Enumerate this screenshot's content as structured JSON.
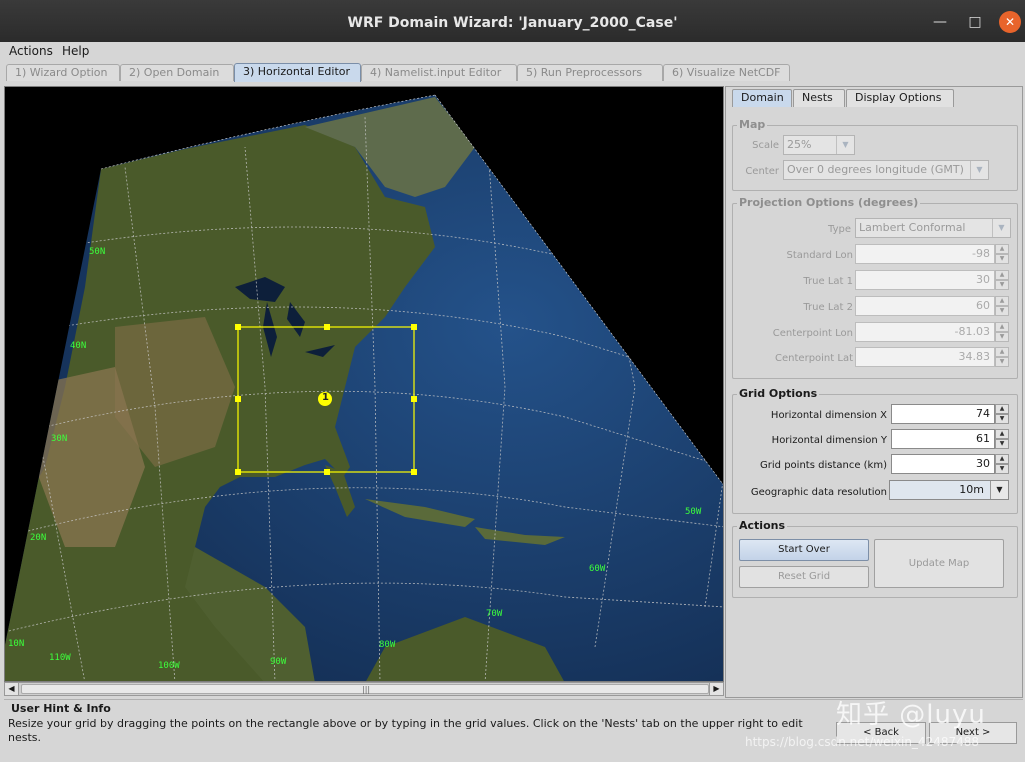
{
  "window": {
    "title": "WRF Domain Wizard: 'January_2000_Case'",
    "min_glyph": "—",
    "max_glyph": "□",
    "close_glyph": "✕"
  },
  "menu": [
    "Actions",
    "Help"
  ],
  "wizard_tabs": [
    {
      "label": "1) Wizard Option",
      "active": false
    },
    {
      "label": "2) Open Domain",
      "active": false
    },
    {
      "label": "3) Horizontal Editor",
      "active": true
    },
    {
      "label": "4) Namelist.input Editor",
      "active": false
    },
    {
      "label": "5) Run Preprocessors",
      "active": false
    },
    {
      "label": "6) Visualize NetCDF",
      "active": false
    }
  ],
  "map": {
    "lat_labels": [
      "50N",
      "40N",
      "30N",
      "20N",
      "10N"
    ],
    "lon_labels": [
      "110W",
      "100W",
      "90W",
      "80W",
      "70W",
      "60W",
      "50W"
    ],
    "domain_marker": "1",
    "colors": {
      "ocean": "#1c3f6e",
      "land": "#4d5a2e",
      "grid": "#c8c8c8",
      "domain_box": "#ffff00",
      "label": "#3cff3c"
    }
  },
  "right_tabs": [
    {
      "label": "Domain",
      "active": true
    },
    {
      "label": "Nests",
      "active": false
    },
    {
      "label": "Display Options",
      "active": false
    }
  ],
  "map_group": {
    "title": "Map",
    "scale_label": "Scale",
    "scale_value": "25%",
    "center_label": "Center",
    "center_value": "Over 0 degrees longitude (GMT)"
  },
  "projection_group": {
    "title": "Projection Options (degrees)",
    "type_label": "Type",
    "type_value": "Lambert Conformal",
    "fields": [
      {
        "label": "Standard Lon",
        "value": "-98"
      },
      {
        "label": "True Lat 1",
        "value": "30"
      },
      {
        "label": "True Lat 2",
        "value": "60"
      },
      {
        "label": "Centerpoint Lon",
        "value": "-81.03"
      },
      {
        "label": "Centerpoint Lat",
        "value": "34.83"
      }
    ]
  },
  "grid_group": {
    "title": "Grid Options",
    "fields": [
      {
        "label": "Horizontal dimension X",
        "value": "74"
      },
      {
        "label": "Horizontal dimension Y",
        "value": "61"
      },
      {
        "label": "Grid points distance (km)",
        "value": "30"
      }
    ],
    "resolution_label": "Geographic data resolution",
    "resolution_value": "10m"
  },
  "actions_group": {
    "title": "Actions",
    "start_over": "Start Over",
    "reset_grid": "Reset Grid",
    "update_map": "Update Map"
  },
  "hint": {
    "title": "User Hint & Info",
    "text": "Resize your grid by dragging the points on the rectangle above or by typing in the grid values. Click on the 'Nests' tab on the upper right to edit nests."
  },
  "nav": {
    "back": "<  Back",
    "next": "Next  >"
  },
  "watermark": {
    "main": "知乎 @luyu",
    "url": "https://blog.csdn.net/weixin_42487488"
  }
}
